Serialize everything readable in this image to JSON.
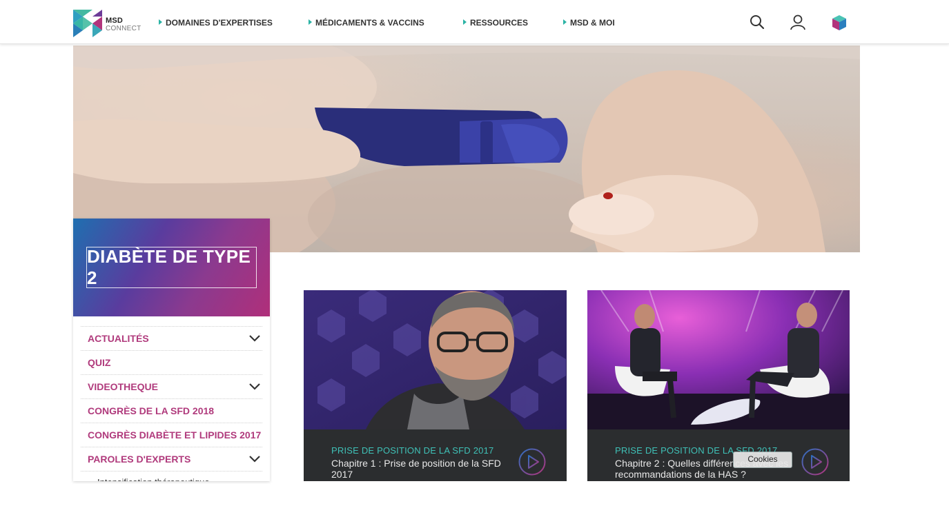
{
  "brand": {
    "name_line1": "MSD",
    "name_line2": "CONNECT"
  },
  "nav": {
    "items": [
      {
        "label": "DOMAINES D'EXPERTISES"
      },
      {
        "label": "MÉDICAMENTS & VACCINS"
      },
      {
        "label": "RESSOURCES"
      },
      {
        "label": "MSD & MOI"
      }
    ],
    "icons": [
      "search-icon",
      "user-icon",
      "cube-icon"
    ]
  },
  "sidebar": {
    "title": "DIABÈTE DE TYPE 2",
    "items": [
      {
        "label": "ACTUALITÉS",
        "expandable": true
      },
      {
        "label": "QUIZ",
        "expandable": false
      },
      {
        "label": "VIDEOTHEQUE",
        "expandable": true
      },
      {
        "label": "CONGRÈS DE LA SFD 2018",
        "expandable": false
      },
      {
        "label": "CONGRÈS DIABÈTE ET LIPIDES 2017",
        "expandable": false
      },
      {
        "label": "PAROLES D'EXPERTS",
        "expandable": true
      }
    ],
    "subitem": "Intensification thérapeutique"
  },
  "videos": [
    {
      "kicker": "PRISE DE POSITION DE LA SFD 2017",
      "title": "Chapitre 1 : Prise de position de la SFD 2017"
    },
    {
      "kicker": "PRISE DE POSITION DE LA SFD 2017",
      "title": "Chapitre 2 : Quelles différences avec les recommandations de la HAS ?"
    }
  ],
  "cookies_label": "Cookies",
  "colors": {
    "accent_teal": "#2bb3a5",
    "menu_magenta": "#b03a7c",
    "banner_gradient": [
      "#1f6fb0",
      "#5a3c9e",
      "#b02f7a"
    ]
  }
}
